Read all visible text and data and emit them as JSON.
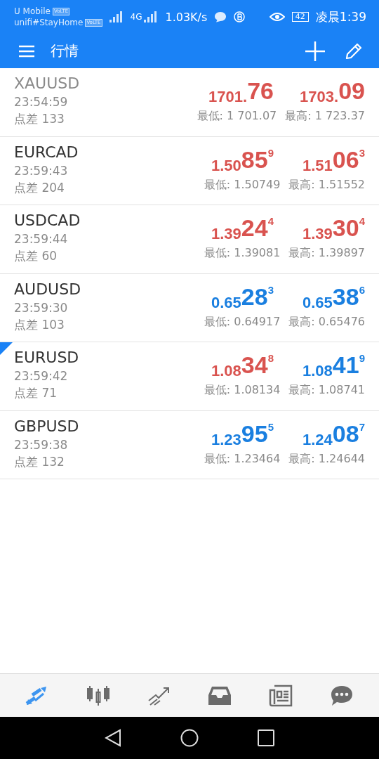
{
  "status_bar": {
    "carrier": "U Mobile",
    "carrier_badge": "VoLTE",
    "network": "unifi#StayHome",
    "network_badge": "VoLTE",
    "signal_label": "4G",
    "speed": "1.03K/s",
    "battery": "42",
    "time": "凌晨1:39"
  },
  "app_bar": {
    "title": "行情"
  },
  "quotes": [
    {
      "symbol": "XAUUSD",
      "dimmed": true,
      "selected": false,
      "time": "23:54:59",
      "spread": "点差 133",
      "bid": {
        "prefix": "1701.",
        "big": "76",
        "color": "#d9534f"
      },
      "ask": {
        "prefix": "1703.",
        "big": "09",
        "color": "#d9534f"
      },
      "low": "最低: 1 701.07",
      "high": "最高: 1 723.37"
    },
    {
      "symbol": "EURCAD",
      "dimmed": false,
      "selected": false,
      "time": "23:59:43",
      "spread": "点差 204",
      "bid": {
        "prefix": "1.50",
        "big": "85",
        "sup": "9",
        "color": "#d9534f"
      },
      "ask": {
        "prefix": "1.51",
        "big": "06",
        "sup": "3",
        "color": "#d9534f"
      },
      "low": "最低: 1.50749",
      "high": "最高: 1.51552"
    },
    {
      "symbol": "USDCAD",
      "dimmed": false,
      "selected": false,
      "time": "23:59:44",
      "spread": "点差 60",
      "bid": {
        "prefix": "1.39",
        "big": "24",
        "sup": "4",
        "color": "#d9534f"
      },
      "ask": {
        "prefix": "1.39",
        "big": "30",
        "sup": "4",
        "color": "#d9534f"
      },
      "low": "最低: 1.39081",
      "high": "最高: 1.39897"
    },
    {
      "symbol": "AUDUSD",
      "dimmed": false,
      "selected": false,
      "time": "23:59:30",
      "spread": "点差 103",
      "bid": {
        "prefix": "0.65",
        "big": "28",
        "sup": "3",
        "color": "#1a7fe0"
      },
      "ask": {
        "prefix": "0.65",
        "big": "38",
        "sup": "6",
        "color": "#1a7fe0"
      },
      "low": "最低: 0.64917",
      "high": "最高: 0.65476"
    },
    {
      "symbol": "EURUSD",
      "dimmed": false,
      "selected": true,
      "time": "23:59:42",
      "spread": "点差 71",
      "bid": {
        "prefix": "1.08",
        "big": "34",
        "sup": "8",
        "color": "#d9534f"
      },
      "ask": {
        "prefix": "1.08",
        "big": "41",
        "sup": "9",
        "color": "#1a7fe0"
      },
      "low": "最低: 1.08134",
      "high": "最高: 1.08741"
    },
    {
      "symbol": "GBPUSD",
      "dimmed": false,
      "selected": false,
      "time": "23:59:38",
      "spread": "点差 132",
      "bid": {
        "prefix": "1.23",
        "big": "95",
        "sup": "5",
        "color": "#1a7fe0"
      },
      "ask": {
        "prefix": "1.24",
        "big": "08",
        "sup": "7",
        "color": "#1a7fe0"
      },
      "low": "最低: 1.23464",
      "high": "最高: 1.24644"
    }
  ],
  "bottom_nav": [
    {
      "kind": "quotes",
      "selected": true
    },
    {
      "kind": "chart",
      "selected": false
    },
    {
      "kind": "trade",
      "selected": false
    },
    {
      "kind": "inbox",
      "selected": false
    },
    {
      "kind": "news",
      "selected": false
    },
    {
      "kind": "chat",
      "selected": false
    }
  ]
}
